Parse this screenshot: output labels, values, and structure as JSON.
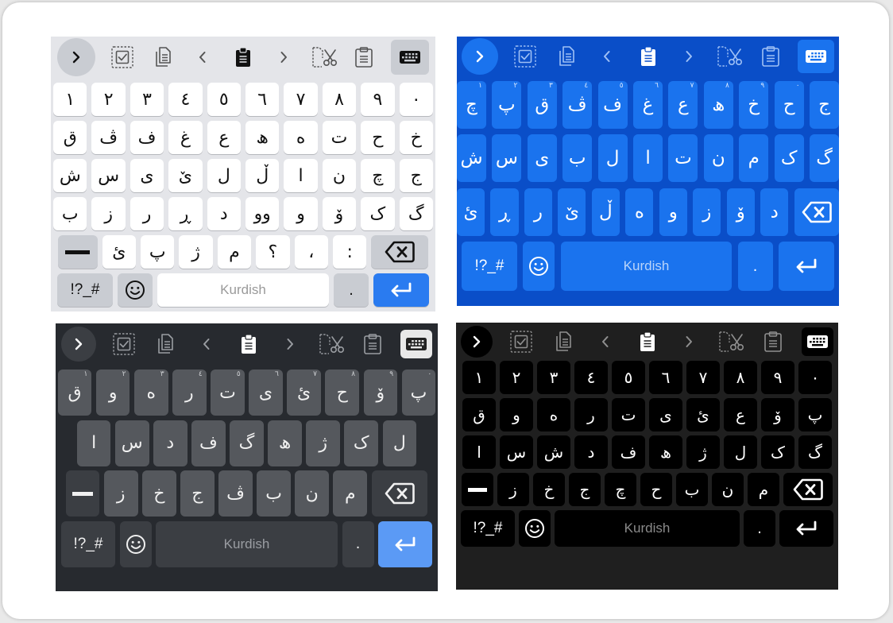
{
  "keyboards": [
    {
      "theme": "light",
      "spacebar_label": "Kurdish",
      "symbols_label": "!?_#",
      "period_label": ".",
      "rows": [
        [
          "١",
          "٢",
          "٣",
          "٤",
          "٥",
          "٦",
          "٧",
          "٨",
          "٩",
          "٠"
        ],
        [
          "ق",
          "ڤ",
          "ف",
          "غ",
          "ع",
          "ھ",
          "ە",
          "ت",
          "ح",
          "خ"
        ],
        [
          "ش",
          "س",
          "ی",
          "ێ",
          "ل",
          "ڵ",
          "ا",
          "ن",
          "چ",
          "ج"
        ],
        [
          "ب",
          "ز",
          "ر",
          "ڕ",
          "د",
          "وو",
          "و",
          "ۆ",
          "ک",
          "گ"
        ],
        [
          "ئ",
          "پ",
          "ژ",
          "م",
          "؟",
          "،",
          ":"
        ]
      ]
    },
    {
      "theme": "blue",
      "spacebar_label": "Kurdish",
      "symbols_label": "!?_#",
      "period_label": ".",
      "hints": [
        "١",
        "٢",
        "٣",
        "٤",
        "٥",
        "٦",
        "٧",
        "٨",
        "٩",
        "٠"
      ],
      "rows": [
        [
          "چ",
          "پ",
          "ق",
          "ڤ",
          "ف",
          "غ",
          "ع",
          "ھ",
          "خ",
          "ح",
          "ج"
        ],
        [
          "ش",
          "س",
          "ی",
          "ب",
          "ل",
          "ا",
          "ت",
          "ن",
          "م",
          "ک",
          "گ"
        ],
        [
          "ئ",
          "ڕ",
          "ر",
          "ێ",
          "ڵ",
          "ە",
          "و",
          "ز",
          "ۆ",
          "د"
        ]
      ]
    },
    {
      "theme": "gray",
      "spacebar_label": "Kurdish",
      "symbols_label": "!?_#",
      "period_label": ".",
      "hints": [
        "١",
        "٢",
        "٣",
        "٤",
        "٥",
        "٦",
        "٧",
        "٨",
        "٩",
        "٠"
      ],
      "rows": [
        [
          "ق",
          "و",
          "ە",
          "ر",
          "ت",
          "ی",
          "ئ",
          "ح",
          "ۆ",
          "پ"
        ],
        [
          "ا",
          "س",
          "د",
          "ف",
          "گ",
          "ھ",
          "ژ",
          "ک",
          "ل"
        ],
        [
          "ز",
          "خ",
          "ج",
          "ڤ",
          "ب",
          "ن",
          "م"
        ]
      ]
    },
    {
      "theme": "black",
      "spacebar_label": "Kurdish",
      "symbols_label": "!?_#",
      "period_label": ".",
      "rows": [
        [
          "١",
          "٢",
          "٣",
          "٤",
          "٥",
          "٦",
          "٧",
          "٨",
          "٩",
          "٠"
        ],
        [
          "ق",
          "و",
          "ە",
          "ر",
          "ت",
          "ی",
          "ئ",
          "ع",
          "ۆ",
          "پ"
        ],
        [
          "ا",
          "س",
          "ش",
          "د",
          "ف",
          "ھ",
          "ژ",
          "ل",
          "ک",
          "گ"
        ],
        [
          "ز",
          "خ",
          "ج",
          "چ",
          "ح",
          "ب",
          "ن",
          "م"
        ]
      ]
    }
  ],
  "toolbar_icons": [
    "expand-chevron-icon",
    "select-all-icon",
    "copy-icon",
    "cursor-left-icon",
    "paste-icon",
    "cursor-right-icon",
    "cut-icon",
    "clipboard-icon",
    "keyboard-icon"
  ]
}
